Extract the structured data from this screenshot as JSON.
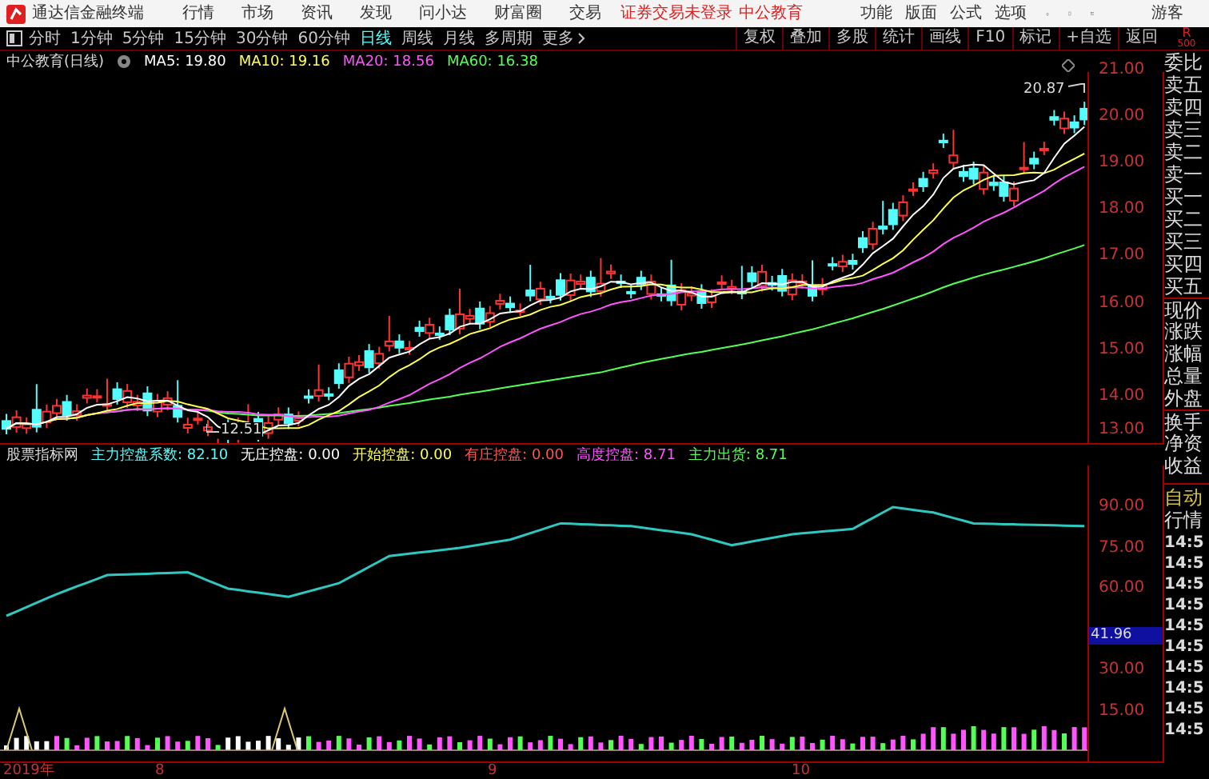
{
  "app": {
    "title": "通达信金融终端",
    "menu": [
      "行情",
      "市场",
      "资讯",
      "发现",
      "问小达",
      "财富圈",
      "交易"
    ],
    "login_notice": "证券交易未登录",
    "account": "中公教育",
    "tools": [
      "功能",
      "版面",
      "公式",
      "选项"
    ],
    "user": "游客"
  },
  "periods": [
    {
      "label": "分时",
      "selected": false
    },
    {
      "label": "1分钟",
      "selected": false
    },
    {
      "label": "5分钟",
      "selected": false
    },
    {
      "label": "15分钟",
      "selected": false
    },
    {
      "label": "30分钟",
      "selected": false
    },
    {
      "label": "60分钟",
      "selected": false
    },
    {
      "label": "日线",
      "selected": true
    },
    {
      "label": "周线",
      "selected": false
    },
    {
      "label": "月线",
      "selected": false
    },
    {
      "label": "多周期",
      "selected": false
    },
    {
      "label": "更多",
      "selected": false
    }
  ],
  "chart_tools": [
    "复权",
    "叠加",
    "多股",
    "统计",
    "画线",
    "F10",
    "标记",
    "+自选",
    "返回"
  ],
  "corner": {
    "line1": "R",
    "line2": "500"
  },
  "info": {
    "title": "中公教育(日线)",
    "ma": [
      {
        "label": "MA5: 19.80",
        "color": "#ffffff"
      },
      {
        "label": "MA10: 19.16",
        "color": "#ffff54"
      },
      {
        "label": "MA20: 18.56",
        "color": "#ff54ff"
      },
      {
        "label": "MA60: 16.38",
        "color": "#54ff54"
      }
    ]
  },
  "price_axis": [
    "21.00",
    "20.00",
    "19.00",
    "18.00",
    "17.00",
    "16.00",
    "15.00",
    "14.00",
    "13.00"
  ],
  "annotations": {
    "high": "20.87",
    "low": "12.51"
  },
  "indicator": {
    "name": "股票指标网",
    "values": [
      {
        "label": "主力控盘系数: 82.10",
        "color": "#54fcfc"
      },
      {
        "label": "无庄控盘: 0.00",
        "color": "#ffffff"
      },
      {
        "label": "开始控盘: 0.00",
        "color": "#ffff54"
      },
      {
        "label": "有庄控盘: 0.00",
        "color": "#ff5454"
      },
      {
        "label": "高度控盘: 8.71",
        "color": "#ff54ff"
      },
      {
        "label": "主力出货: 8.71",
        "color": "#54ff54"
      }
    ]
  },
  "indicator_axis": [
    "90.00",
    "75.00",
    "60.00",
    "30.00",
    "15.00"
  ],
  "indicator_marker": "41.96",
  "dates": [
    "2019年",
    "8",
    "9",
    "10"
  ],
  "quote_panel": {
    "labels": [
      "委比",
      "卖五",
      "卖四",
      "卖三",
      "卖二",
      "卖一",
      "买一",
      "买二",
      "买三",
      "买四",
      "买五",
      "现价",
      "涨跌",
      "涨幅",
      "总量",
      "外盘",
      "换手",
      "净资",
      "收益"
    ],
    "auto": "自动",
    "market": "行情",
    "times": [
      "14:5",
      "14:5",
      "14:5",
      "14:5",
      "14:5",
      "14:5",
      "14:5",
      "14:5",
      "14:5",
      "14:5"
    ]
  }
}
